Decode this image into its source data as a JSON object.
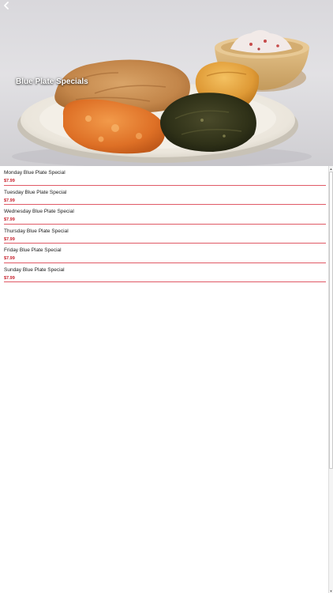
{
  "header": {
    "title": "Blue Plate Specials",
    "back_icon": "chevron-left-icon"
  },
  "menu": {
    "items": [
      {
        "name": "Monday Blue Plate Special",
        "price": "$7.99"
      },
      {
        "name": "Tuesday Blue Plate Special",
        "price": "$7.99"
      },
      {
        "name": "Wednesday Blue Plate Special",
        "price": "$7.99"
      },
      {
        "name": "Thursday Blue Plate Special",
        "price": "$7.99"
      },
      {
        "name": "Friday Blue Plate Special",
        "price": "$7.99"
      },
      {
        "name": "Sunday Blue Plate Special",
        "price": "$7.99"
      }
    ]
  },
  "colors": {
    "price": "#c6202c",
    "divider": "#e05a66",
    "title": "#ffffff"
  }
}
